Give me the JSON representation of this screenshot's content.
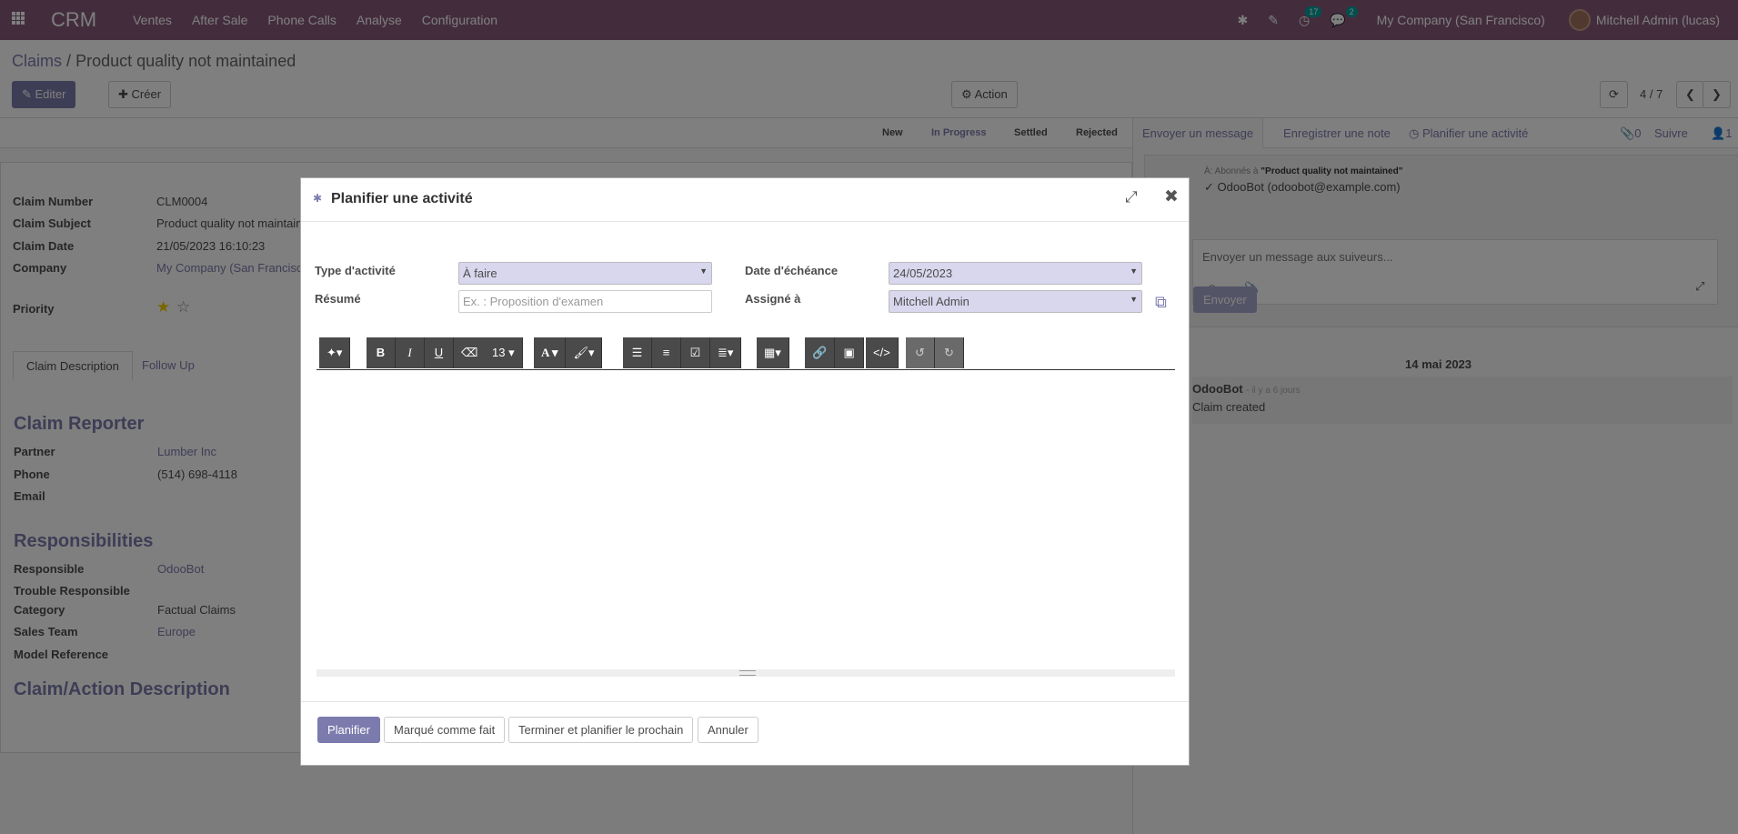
{
  "navbar": {
    "app_name": "CRM",
    "menu": [
      "Ventes",
      "After Sale",
      "Phone Calls",
      "Analyse",
      "Configuration"
    ],
    "activity_count": "17",
    "message_count": "2",
    "company": "My Company (San Francisco)",
    "user": "Mitchell Admin (lucas)",
    "accent_color": "#875a7b"
  },
  "control_panel": {
    "breadcrumb_parent": "Claims",
    "breadcrumb_separator": "/",
    "breadcrumb_current": "Product quality not maintained",
    "edit_label": "Editer",
    "create_label": "Créer",
    "action_label": "Action",
    "pager": "4 / 7"
  },
  "statusbar": {
    "stages": [
      "New",
      "In Progress",
      "Settled",
      "Rejected"
    ],
    "active_stage": "In Progress"
  },
  "form": {
    "fields": [
      {
        "label": "Claim Number",
        "value": "CLM0004"
      },
      {
        "label": "Claim Subject",
        "value": "Product quality not maintain"
      },
      {
        "label": "Claim Date",
        "value": "21/05/2023 16:10:23"
      },
      {
        "label": "Company",
        "value": "My Company (San Francisc"
      }
    ],
    "priority_label": "Priority",
    "tabs": [
      "Claim Description",
      "Follow Up"
    ],
    "reporter_title": "Claim Reporter",
    "reporter": [
      {
        "label": "Partner",
        "value": "Lumber Inc"
      },
      {
        "label": "Phone",
        "value": "(514) 698-4118"
      },
      {
        "label": "Email",
        "value": ""
      }
    ],
    "responsibilities_title": "Responsibilities",
    "responsibilities": [
      {
        "label": "Responsible",
        "value": "OdooBot"
      },
      {
        "label": "Trouble Responsible",
        "value": ""
      },
      {
        "label": "Category",
        "value": "Factual Claims"
      },
      {
        "label": "Sales Team",
        "value": "Europe"
      },
      {
        "label": "Model Reference",
        "value": ""
      }
    ],
    "action_desc_title": "Claim/Action Description"
  },
  "chatter": {
    "send_message": "Envoyer un message",
    "log_note": "Enregistrer une note",
    "schedule_activity": "Planifier une activité",
    "attachments": "0",
    "follow": "Suivre",
    "followers": "1",
    "to_prefix": "À: Abonnés à",
    "to_record": "\"Product quality not maintained\"",
    "recipient": "OdooBot (odoobot@example.com)",
    "composer_placeholder": "Envoyer un message aux suiveurs...",
    "send_label": "Envoyer",
    "date_separator": "14 mai 2023",
    "message_author": "OdooBot",
    "message_time": "- il y a 6 jours",
    "message_body": "Claim created"
  },
  "modal": {
    "title": "Planifier une activité",
    "activity_type_label": "Type d'activité",
    "activity_type_value": "À faire",
    "summary_label": "Résumé",
    "summary_placeholder": "Ex. : Proposition d'examen",
    "due_date_label": "Date d'échéance",
    "due_date_value": "24/05/2023",
    "assigned_label": "Assigné à",
    "assigned_value": "Mitchell Admin",
    "font_size": "13",
    "buttons": {
      "schedule": "Planifier",
      "mark_done": "Marqué comme fait",
      "done_schedule_next": "Terminer et planifier le prochain",
      "cancel": "Annuler"
    }
  }
}
